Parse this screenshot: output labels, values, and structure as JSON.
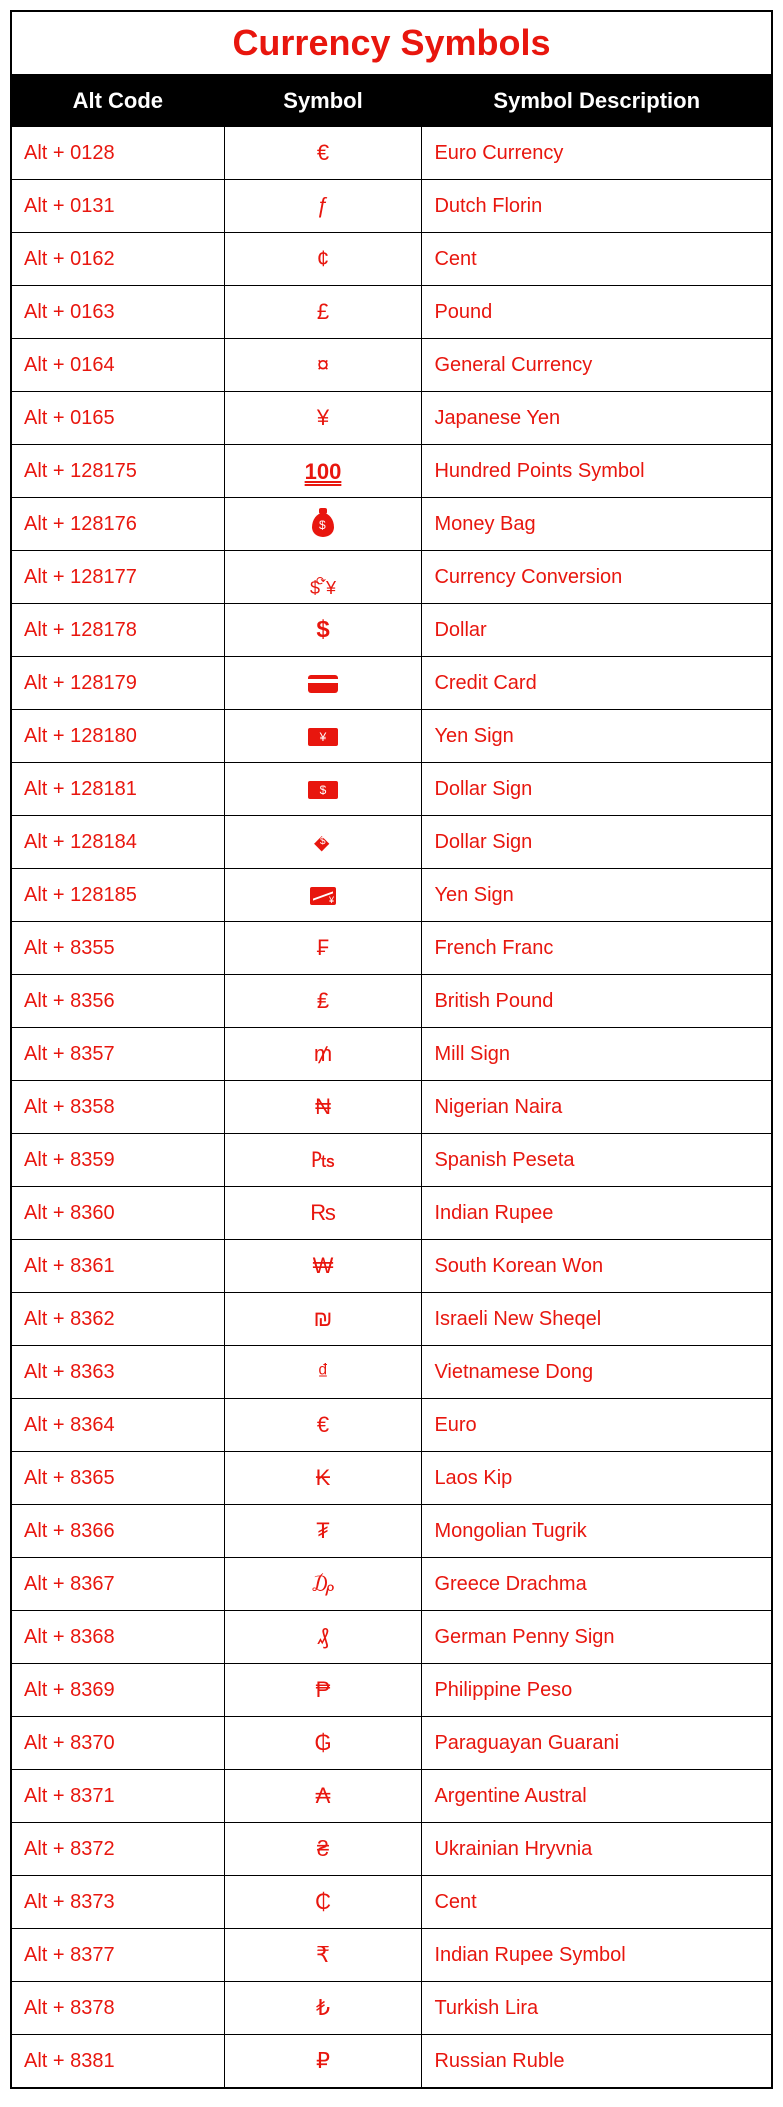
{
  "title": "Currency Symbols",
  "headers": {
    "alt_code": "Alt Code",
    "symbol": "Symbol",
    "description": "Symbol Description"
  },
  "rows": [
    {
      "alt": "Alt + 0128",
      "symbol": "€",
      "desc": "Euro Currency",
      "icon": ""
    },
    {
      "alt": "Alt + 0131",
      "symbol": "ƒ",
      "desc": "Dutch Florin",
      "icon": ""
    },
    {
      "alt": "Alt + 0162",
      "symbol": "¢",
      "desc": "Cent",
      "icon": ""
    },
    {
      "alt": "Alt + 0163",
      "symbol": "£",
      "desc": "Pound",
      "icon": ""
    },
    {
      "alt": "Alt + 0164",
      "symbol": "¤",
      "desc": "General Currency",
      "icon": ""
    },
    {
      "alt": "Alt + 0165",
      "symbol": "¥",
      "desc": "Japanese Yen",
      "icon": ""
    },
    {
      "alt": "Alt + 128175",
      "symbol": "100",
      "desc": "Hundred Points Symbol",
      "icon": "hundred"
    },
    {
      "alt": "Alt + 128176",
      "symbol": "",
      "desc": "Money Bag",
      "icon": "moneybag"
    },
    {
      "alt": "Alt + 128177",
      "symbol": "",
      "desc": "Currency Conversion",
      "icon": "convert"
    },
    {
      "alt": "Alt + 128178",
      "symbol": "$",
      "desc": "Dollar",
      "icon": "heavy-dollar"
    },
    {
      "alt": "Alt + 128179",
      "symbol": "",
      "desc": "Credit Card",
      "icon": "card"
    },
    {
      "alt": "Alt + 128180",
      "symbol": "¥",
      "desc": "Yen Sign",
      "icon": "yen-banknote"
    },
    {
      "alt": "Alt + 128181",
      "symbol": "$",
      "desc": "Dollar Sign",
      "icon": "dollar-banknote"
    },
    {
      "alt": "Alt + 128184",
      "symbol": "",
      "desc": "Dollar Sign",
      "icon": "money-wings"
    },
    {
      "alt": "Alt + 128185",
      "symbol": "",
      "desc": "Yen Sign",
      "icon": "chart"
    },
    {
      "alt": "Alt + 8355",
      "symbol": "₣",
      "desc": "French Franc",
      "icon": ""
    },
    {
      "alt": "Alt + 8356",
      "symbol": "₤",
      "desc": "British Pound",
      "icon": ""
    },
    {
      "alt": "Alt + 8357",
      "symbol": "₥",
      "desc": "Mill Sign",
      "icon": ""
    },
    {
      "alt": "Alt + 8358",
      "symbol": "₦",
      "desc": "Nigerian Naira",
      "icon": ""
    },
    {
      "alt": "Alt + 8359",
      "symbol": "₧",
      "desc": "Spanish Peseta",
      "icon": ""
    },
    {
      "alt": "Alt + 8360",
      "symbol": "₨",
      "desc": "Indian Rupee",
      "icon": ""
    },
    {
      "alt": "Alt + 8361",
      "symbol": "₩",
      "desc": "South Korean Won",
      "icon": ""
    },
    {
      "alt": "Alt + 8362",
      "symbol": "₪",
      "desc": "Israeli New Sheqel",
      "icon": ""
    },
    {
      "alt": "Alt + 8363",
      "symbol": "₫",
      "desc": "Vietnamese Dong",
      "icon": ""
    },
    {
      "alt": "Alt + 8364",
      "symbol": "€",
      "desc": "Euro",
      "icon": ""
    },
    {
      "alt": "Alt + 8365",
      "symbol": "₭",
      "desc": "Laos Kip",
      "icon": ""
    },
    {
      "alt": "Alt + 8366",
      "symbol": "₮",
      "desc": "Mongolian Tugrik",
      "icon": ""
    },
    {
      "alt": "Alt + 8367",
      "symbol": "₯",
      "desc": "Greece Drachma",
      "icon": ""
    },
    {
      "alt": "Alt + 8368",
      "symbol": "₰",
      "desc": "German Penny  Sign",
      "icon": ""
    },
    {
      "alt": "Alt + 8369",
      "symbol": "₱",
      "desc": "Philippine Peso",
      "icon": ""
    },
    {
      "alt": "Alt + 8370",
      "symbol": "₲",
      "desc": "Paraguayan Guarani",
      "icon": ""
    },
    {
      "alt": "Alt + 8371",
      "symbol": "₳",
      "desc": "Argentine Austral",
      "icon": ""
    },
    {
      "alt": "Alt + 8372",
      "symbol": "₴",
      "desc": "Ukrainian Hryvnia",
      "icon": ""
    },
    {
      "alt": "Alt + 8373",
      "symbol": "₵",
      "desc": "Cent",
      "icon": ""
    },
    {
      "alt": "Alt + 8377",
      "symbol": "₹",
      "desc": "Indian Rupee Symbol",
      "icon": ""
    },
    {
      "alt": "Alt + 8378",
      "symbol": "₺",
      "desc": "Turkish Lira",
      "icon": ""
    },
    {
      "alt": "Alt + 8381",
      "symbol": "₽",
      "desc": "Russian Ruble",
      "icon": ""
    }
  ]
}
